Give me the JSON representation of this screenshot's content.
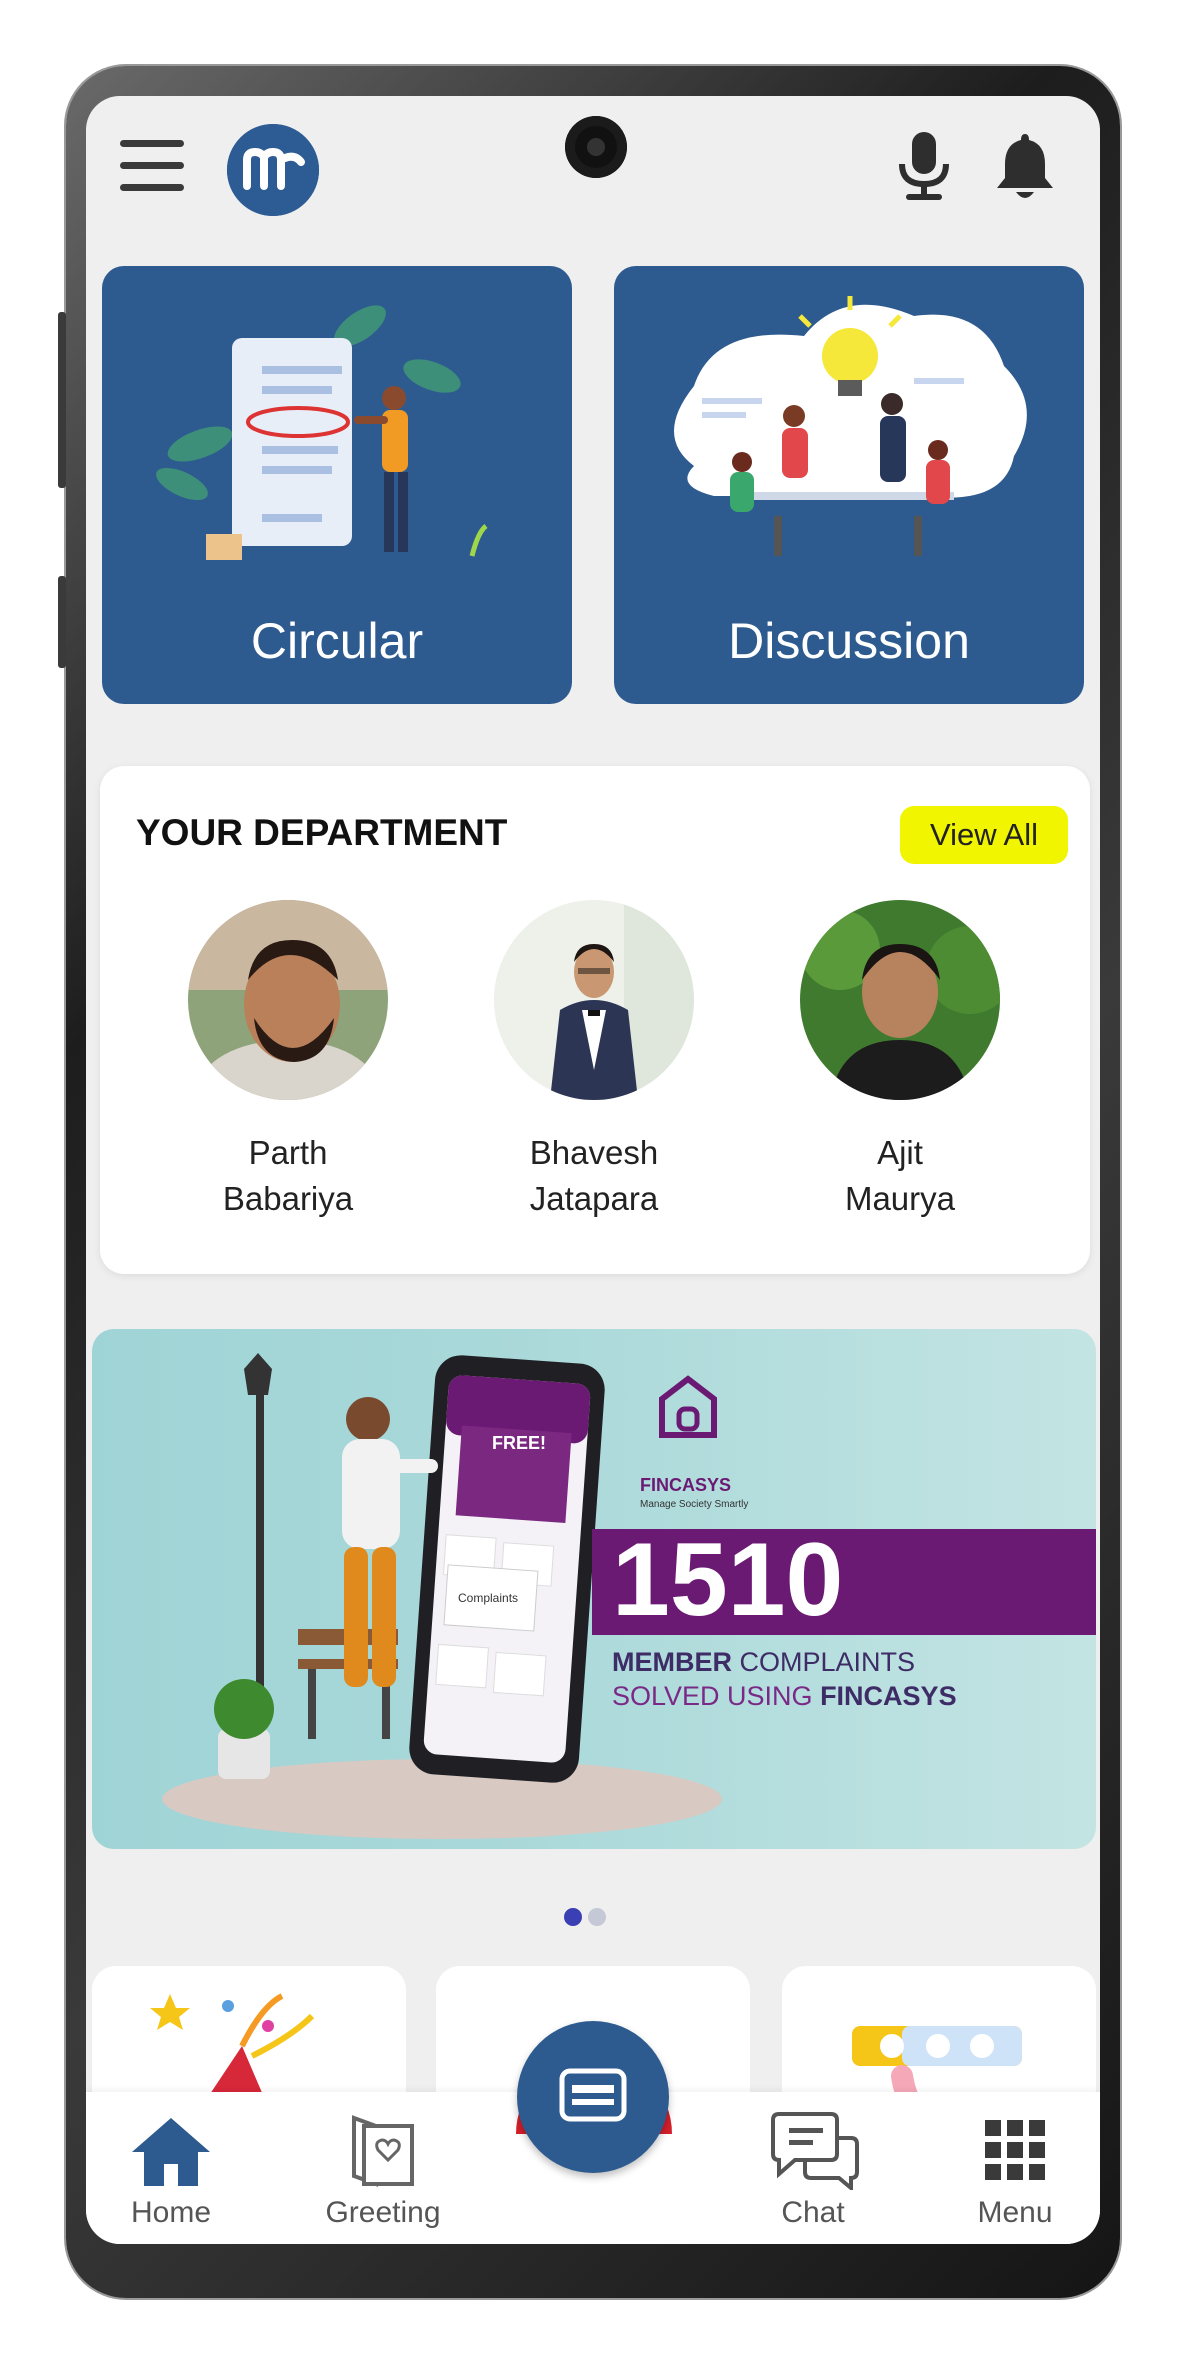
{
  "app": {
    "logo_text": "m"
  },
  "tiles": [
    {
      "label": "Circular"
    },
    {
      "label": "Discussion"
    }
  ],
  "department": {
    "title": "YOUR DEPARTMENT",
    "view_all": "View All",
    "members": [
      {
        "first": "Parth",
        "last": "Babariya"
      },
      {
        "first": "Bhavesh",
        "last": "Jatapara"
      },
      {
        "first": "Ajit",
        "last": "Maurya"
      }
    ]
  },
  "banner": {
    "brand": "FINCASYS",
    "tagline": "Manage Society Smartly",
    "phone_free": "FREE!",
    "phone_complaints": "Complaints",
    "number": "1510",
    "line1_bold": "MEMBER",
    "line1_rest": " COMPLAINTS",
    "line2_rest": "SOLVED USING ",
    "line2_bold": "FINCASYS"
  },
  "carousel": {
    "active_index": 0,
    "count": 2
  },
  "nav": {
    "home": "Home",
    "greeting": "Greeting",
    "chat": "Chat",
    "menu": "Menu"
  },
  "colors": {
    "primary": "#2d5b8f",
    "accent_yellow": "#f1f500",
    "banner_purple": "#6b1a73",
    "fab_ring": "#d61f2b"
  }
}
